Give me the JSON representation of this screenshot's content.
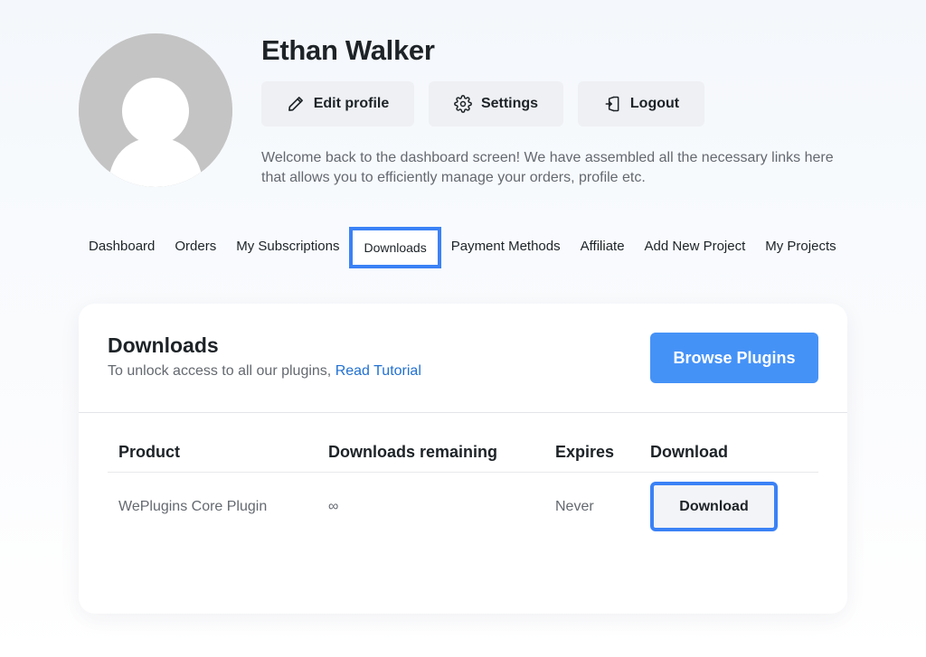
{
  "profile": {
    "name": "Ethan Walker",
    "welcome": "Welcome back to the dashboard screen! We have assembled all the necessary links here that allows you to efficiently manage your orders, profile etc.",
    "actions": {
      "edit_label": "Edit profile",
      "settings_label": "Settings",
      "logout_label": "Logout"
    }
  },
  "nav": {
    "items": [
      "Dashboard",
      "Orders",
      "My Subscriptions",
      "Downloads",
      "Payment Methods",
      "Affiliate",
      "Add New Project",
      "My Projects"
    ],
    "active": "Downloads"
  },
  "downloads_card": {
    "title": "Downloads",
    "subtitle": "To unlock access to all our plugins,",
    "tutorial_link": "Read Tutorial",
    "browse_label": "Browse Plugins",
    "columns": [
      "Product",
      "Downloads remaining",
      "Expires",
      "Download"
    ],
    "rows": [
      {
        "product": "WePlugins Core Plugin",
        "remaining": "∞",
        "expires": "Never",
        "download_label": "Download"
      }
    ]
  },
  "icons": {
    "edit": "pencil-icon",
    "settings": "gear-icon",
    "logout": "logout-icon"
  },
  "colors": {
    "accent": "#4592f7",
    "highlight": "#3b82f6",
    "link": "#2271d1"
  }
}
